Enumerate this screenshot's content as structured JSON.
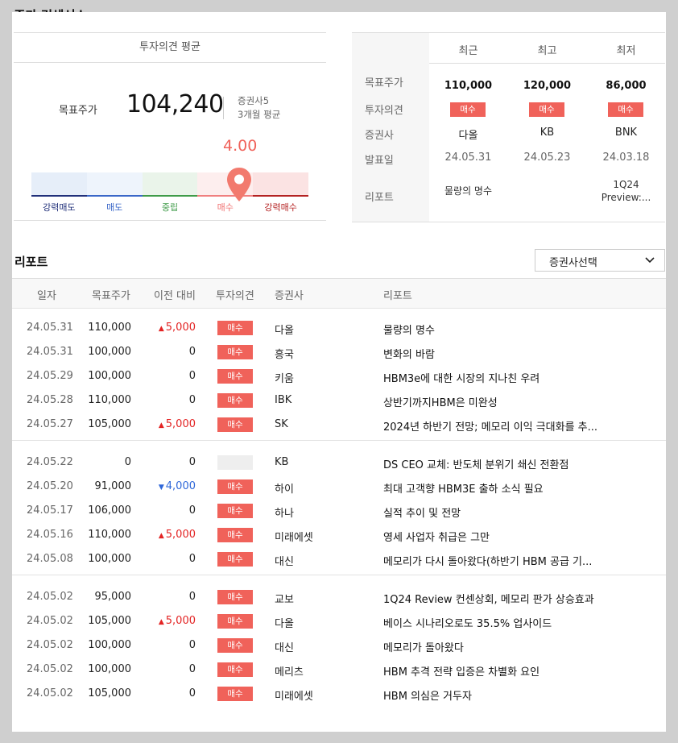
{
  "page_title": "주가 컨센서스",
  "consensus": {
    "header": "투자의견 평균",
    "target_label": "목표주가",
    "target_value": "104,240",
    "brokers_count": "증권사5",
    "period": "3개월 평균",
    "score": "4.00",
    "score_value": 4.0,
    "gauge": [
      {
        "label": "강력매도",
        "color": "#e6eef9",
        "line": "#21307a",
        "text": "#21307a"
      },
      {
        "label": "매도",
        "color": "#eef4fc",
        "line": "#3a67c8",
        "text": "#3a67c8"
      },
      {
        "label": "중립",
        "color": "#eaf4ea",
        "line": "#3f9b49",
        "text": "#3f9b49"
      },
      {
        "label": "매수",
        "color": "#fdeeee",
        "line": "#f08080",
        "text": "#f07070"
      },
      {
        "label": "강력매수",
        "color": "#fbe3e3",
        "line": "#b42222",
        "text": "#b42222"
      }
    ]
  },
  "summary": {
    "row_labels": [
      "목표주가",
      "투자의견",
      "증권사",
      "발표일",
      "리포트"
    ],
    "columns": [
      {
        "header": "최근",
        "price": "110,000",
        "opinion": "매수",
        "broker": "다올",
        "date": "24.05.31",
        "report": "물량의 명수"
      },
      {
        "header": "최고",
        "price": "120,000",
        "opinion": "매수",
        "broker": "KB",
        "date": "24.05.23",
        "report": ""
      },
      {
        "header": "최저",
        "price": "86,000",
        "opinion": "매수",
        "broker": "BNK",
        "date": "24.03.18",
        "report_line1": "1Q24",
        "report_line2": "Preview:..."
      }
    ]
  },
  "reports": {
    "title": "리포트",
    "select_label": "증권사선택",
    "headers": [
      "일자",
      "목표주가",
      "이전 대비",
      "투자의견",
      "증권사",
      "리포트"
    ],
    "groups": [
      [
        {
          "date": "24.05.31",
          "target": "110,000",
          "change": "5,000",
          "dir": "up",
          "opinion": "매수",
          "broker": "다올",
          "title": "물량의 명수"
        },
        {
          "date": "24.05.31",
          "target": "100,000",
          "change": "0",
          "dir": "flat",
          "opinion": "매수",
          "broker": "흥국",
          "title": "변화의 바람"
        },
        {
          "date": "24.05.29",
          "target": "100,000",
          "change": "0",
          "dir": "flat",
          "opinion": "매수",
          "broker": "키움",
          "title": "HBM3e에 대한 시장의 지나친 우려"
        },
        {
          "date": "24.05.28",
          "target": "110,000",
          "change": "0",
          "dir": "flat",
          "opinion": "매수",
          "broker": "IBK",
          "title": "상반기까지HBM은 미완성"
        },
        {
          "date": "24.05.27",
          "target": "105,000",
          "change": "5,000",
          "dir": "up",
          "opinion": "매수",
          "broker": "SK",
          "title": "2024년 하반기 전망; 메모리 이익 극대화를 추..."
        }
      ],
      [
        {
          "date": "24.05.22",
          "target": "0",
          "change": "0",
          "dir": "flat",
          "opinion": "",
          "broker": "KB",
          "title": "DS CEO 교체: 반도체 분위기 쇄신 전환점"
        },
        {
          "date": "24.05.20",
          "target": "91,000",
          "change": "4,000",
          "dir": "down",
          "opinion": "매수",
          "broker": "하이",
          "title": "최대 고객향 HBM3E 출하 소식 필요"
        },
        {
          "date": "24.05.17",
          "target": "106,000",
          "change": "0",
          "dir": "flat",
          "opinion": "매수",
          "broker": "하나",
          "title": "실적 추이 및 전망"
        },
        {
          "date": "24.05.16",
          "target": "110,000",
          "change": "5,000",
          "dir": "up",
          "opinion": "매수",
          "broker": "미래에셋",
          "title": "영세 사업자 취급은 그만"
        },
        {
          "date": "24.05.08",
          "target": "100,000",
          "change": "0",
          "dir": "flat",
          "opinion": "매수",
          "broker": "대신",
          "title": "메모리가 다시 돌아왔다(하반기 HBM 공급 기..."
        }
      ],
      [
        {
          "date": "24.05.02",
          "target": "95,000",
          "change": "0",
          "dir": "flat",
          "opinion": "매수",
          "broker": "교보",
          "title": "1Q24 Review 컨센상회, 메모리 판가 상승효과"
        },
        {
          "date": "24.05.02",
          "target": "105,000",
          "change": "5,000",
          "dir": "up",
          "opinion": "매수",
          "broker": "다올",
          "title": "베이스 시나리오로도 35.5% 업사이드"
        },
        {
          "date": "24.05.02",
          "target": "100,000",
          "change": "0",
          "dir": "flat",
          "opinion": "매수",
          "broker": "대신",
          "title": "메모리가 돌아왔다"
        },
        {
          "date": "24.05.02",
          "target": "100,000",
          "change": "0",
          "dir": "flat",
          "opinion": "매수",
          "broker": "메리츠",
          "title": "HBM 추격 전략 입증은 차별화 요인"
        },
        {
          "date": "24.05.02",
          "target": "105,000",
          "change": "0",
          "dir": "flat",
          "opinion": "매수",
          "broker": "미래에셋",
          "title": "HBM 의심은 거두자"
        }
      ]
    ]
  }
}
